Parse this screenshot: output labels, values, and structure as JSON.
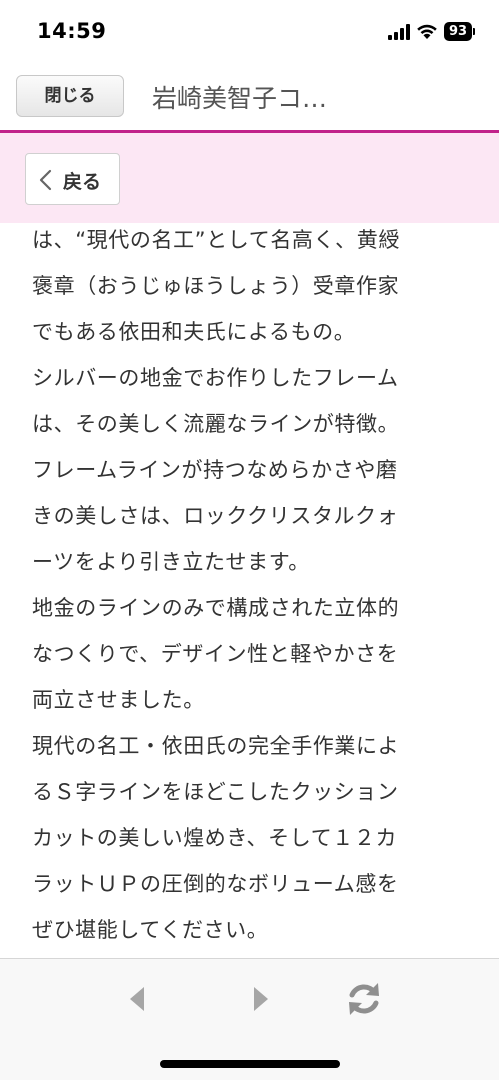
{
  "status_bar": {
    "time": "14:59",
    "battery_level": "93",
    "icons": [
      "signal-icon",
      "wifi-icon",
      "battery-icon"
    ]
  },
  "title_bar": {
    "close_label": "閉じる",
    "page_title": "岩崎美智子コ…"
  },
  "back_bar": {
    "back_label": "戻る",
    "icon": "chevron-left-icon"
  },
  "article": {
    "lines": [
      "は、“現代の名工”として名高く、黄綬",
      "褒章（おうじゅほうしょう）受章作家",
      "でもある依田和夫氏によるもの。",
      "シルバーの地金でお作りしたフレーム",
      "は、その美しく流麗なラインが特徴。",
      "フレームラインが持つなめらかさや磨",
      "きの美しさは、ロッククリスタルクォ",
      "ーツをより引き立たせます。",
      "地金のラインのみで構成された立体的",
      "なつくりで、デザイン性と軽やかさを",
      "両立させました。",
      "現代の名工・依田氏の完全手作業によ",
      "るＳ字ラインをほどこしたクッション",
      "カットの美しい煌めき、そして１２カ",
      "ラットＵＰの圧倒的なボリューム感を",
      "ぜひ堪能してください。"
    ]
  },
  "toolbar": {
    "icons": [
      "nav-back-icon",
      "nav-forward-icon",
      "reload-icon"
    ]
  },
  "colors": {
    "accent": "#c1228a",
    "back_bar_bg": "#fce6f4",
    "toolbar_icon": "#9a9a9a"
  }
}
